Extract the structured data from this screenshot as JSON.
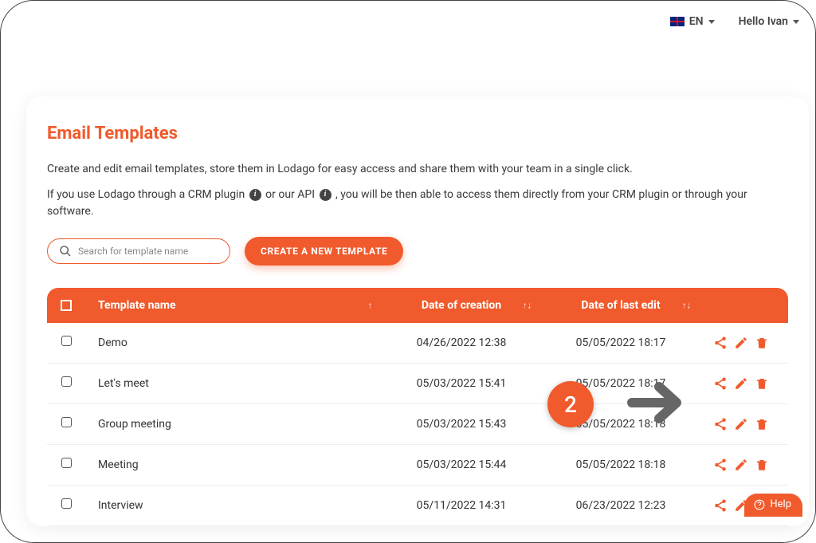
{
  "header": {
    "language_code": "EN",
    "greeting": "Hello Ivan"
  },
  "page": {
    "title": "Email Templates",
    "description1": "Create and edit email templates, store them in Lodago for easy access and share them with your team in a single click.",
    "description2_a": "If you use Lodago through a CRM plugin",
    "description2_b": "or our API",
    "description2_c": ", you will be then able to access them directly from your CRM plugin or through your software."
  },
  "controls": {
    "search_placeholder": "Search for template name",
    "create_button": "CREATE A NEW TEMPLATE"
  },
  "table": {
    "columns": {
      "name": "Template name",
      "created": "Date of creation",
      "edited": "Date of last edit"
    },
    "rows": [
      {
        "name": "Demo",
        "created": "04/26/2022 12:38",
        "edited": "05/05/2022 18:17"
      },
      {
        "name": "Let's meet",
        "created": "05/03/2022 15:41",
        "edited": "05/05/2022 18:17"
      },
      {
        "name": "Group meeting",
        "created": "05/03/2022 15:43",
        "edited": "05/05/2022 18:18"
      },
      {
        "name": "Meeting",
        "created": "05/03/2022 15:44",
        "edited": "05/05/2022 18:18"
      },
      {
        "name": "Interview",
        "created": "05/11/2022 14:31",
        "edited": "06/23/2022 12:23"
      }
    ]
  },
  "annotation": {
    "badge": "2"
  },
  "help": {
    "label": "Help"
  }
}
